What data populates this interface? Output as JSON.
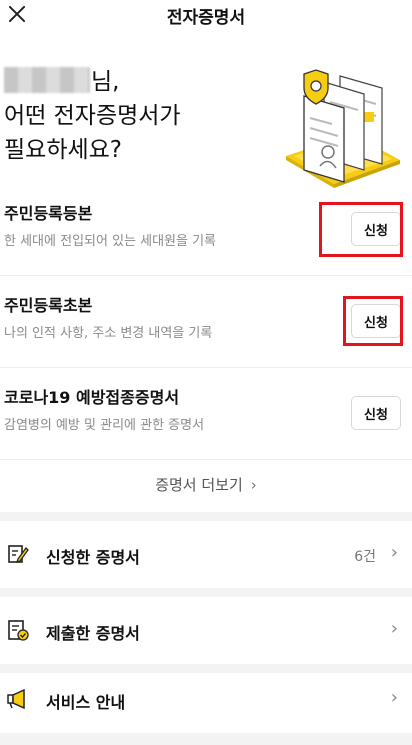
{
  "header": {
    "title": "전자증명서"
  },
  "hero": {
    "greeting_suffix": "님,",
    "line2": "어떤 전자증명서가",
    "line3": "필요하세요?"
  },
  "certificates": [
    {
      "name": "주민등록등본",
      "description": "한 세대에 전입되어 있는 세대원을 기록",
      "button": "신청"
    },
    {
      "name": "주민등록초본",
      "description": "나의 인적 사항, 주소 변경 내역을 기록",
      "button": "신청"
    },
    {
      "name": "코로나19 예방접종증명서",
      "description": "감염병의 예방 및 관리에 관한 증명서",
      "button": "신청"
    }
  ],
  "more": {
    "label": "증명서 더보기",
    "chevron": "›"
  },
  "menu": [
    {
      "label": "신청한 증명서",
      "count": "6건",
      "icon": "edit-document-icon"
    },
    {
      "label": "제출한 증명서",
      "count": "",
      "icon": "submitted-document-icon"
    },
    {
      "label": "서비스 안내",
      "count": "",
      "icon": "megaphone-icon"
    }
  ],
  "colors": {
    "accent": "#f7d21f",
    "highlight_box": "#e5141c",
    "separator": "#f3f3f3"
  }
}
